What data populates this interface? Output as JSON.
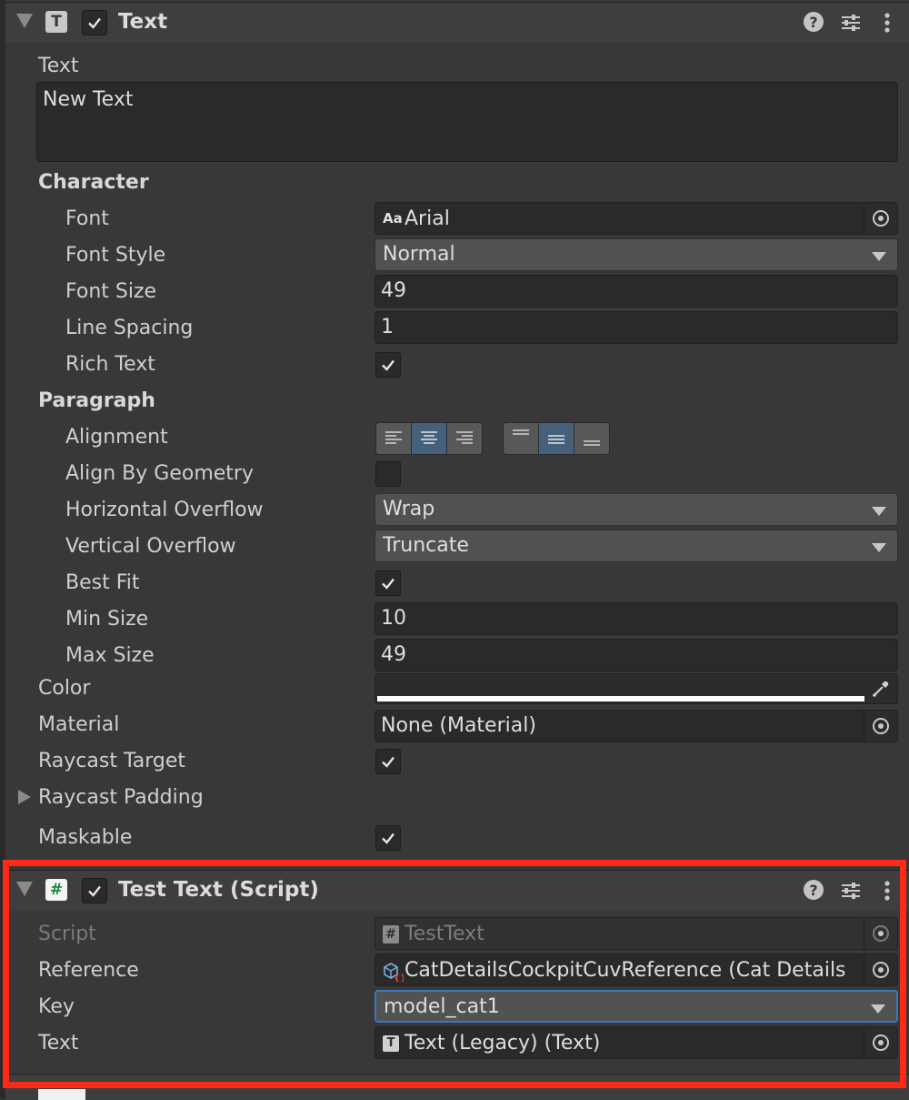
{
  "text_component": {
    "title": "Text",
    "enabled": true,
    "text_label": "Text",
    "text_value": "New Text",
    "character_label": "Character",
    "font_label": "Font",
    "font_icon": "Aa",
    "font_value": "Arial",
    "font_style_label": "Font Style",
    "font_style_value": "Normal",
    "font_size_label": "Font Size",
    "font_size_value": "49",
    "line_spacing_label": "Line Spacing",
    "line_spacing_value": "1",
    "rich_text_label": "Rich Text",
    "rich_text_checked": true,
    "paragraph_label": "Paragraph",
    "alignment_label": "Alignment",
    "horizontal_alignment_selected": "center",
    "vertical_alignment_selected": "middle",
    "align_by_geometry_label": "Align By Geometry",
    "align_by_geometry_checked": false,
    "horizontal_overflow_label": "Horizontal Overflow",
    "horizontal_overflow_value": "Wrap",
    "vertical_overflow_label": "Vertical Overflow",
    "vertical_overflow_value": "Truncate",
    "best_fit_label": "Best Fit",
    "best_fit_checked": true,
    "min_size_label": "Min Size",
    "min_size_value": "10",
    "max_size_label": "Max Size",
    "max_size_value": "49",
    "color_label": "Color",
    "color_value": "#ffffff",
    "material_label": "Material",
    "material_value": "None (Material)",
    "raycast_target_label": "Raycast Target",
    "raycast_target_checked": true,
    "raycast_padding_label": "Raycast Padding",
    "maskable_label": "Maskable",
    "maskable_checked": true
  },
  "script_component": {
    "title": "Test Text (Script)",
    "enabled": true,
    "script_label": "Script",
    "script_value": "TestText",
    "reference_label": "Reference",
    "reference_value": "CatDetailsCockpitCuvReference (Cat Details",
    "key_label": "Key",
    "key_value": "model_cat1",
    "text_label": "Text",
    "text_value": "Text (Legacy) (Text)"
  },
  "colors": {
    "background": "#383838",
    "highlight": "#ff2a16",
    "selected_button": "#46607c",
    "focus_outline": "#3a79bb"
  }
}
